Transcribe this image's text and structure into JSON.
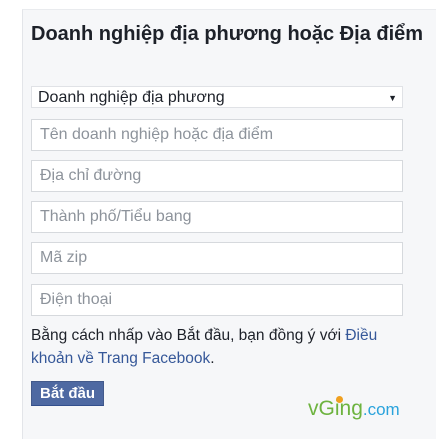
{
  "header": {
    "title": "Doanh nghiệp địa phương hoặc Địa điểm"
  },
  "category_select": {
    "selected": "Doanh nghiệp địa phương",
    "arrow": "▼"
  },
  "form": {
    "business_name_placeholder": "Tên doanh nghiệp hoặc địa điểm",
    "street_placeholder": "Địa chỉ đường",
    "city_state_placeholder": "Thành phố/Tiểu bang",
    "zip_placeholder": "Mã zip",
    "phone_placeholder": "Điện thoại"
  },
  "terms": {
    "text": "Bằng cách nhấp vào Bắt đầu, bạn đồng ý với ",
    "link": "Điều khoản về Trang Facebook",
    "suffix": "."
  },
  "actions": {
    "start_label": "Bắt đầu"
  },
  "watermark": {
    "prefix": "vG",
    "i": "i",
    "suffix": "ng",
    "tld": ".com"
  },
  "colors": {
    "button_bg": "#4e69a2",
    "link": "#365899",
    "watermark_green": "#6db33f",
    "watermark_blue": "#2aa3dc"
  }
}
